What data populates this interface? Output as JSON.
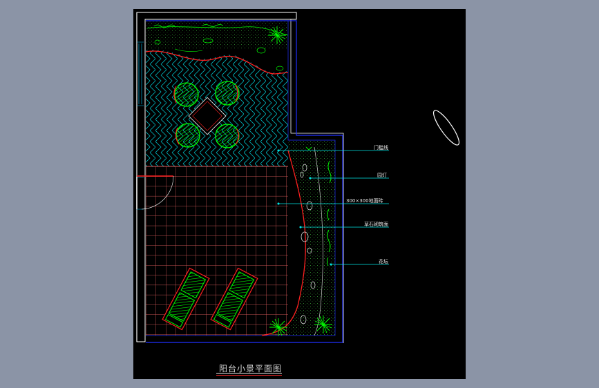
{
  "drawing": {
    "title": "阳台小景平面图",
    "callouts": [
      {
        "id": "c1",
        "text": "门槛线"
      },
      {
        "id": "c2",
        "text": "园灯"
      },
      {
        "id": "c3",
        "text": "300×300地面砖"
      },
      {
        "id": "c4",
        "text": "草石砌筑面"
      },
      {
        "id": "c5",
        "text": "花坛"
      }
    ]
  },
  "colors": {
    "background": "#000000",
    "wall": "#ffffff",
    "outline": "#1e2bff",
    "hatch": "#00c8c8",
    "tile": "#ff7070",
    "plant": "#00ff00",
    "leader": "#00e5e5",
    "edge": "#ff2020"
  }
}
